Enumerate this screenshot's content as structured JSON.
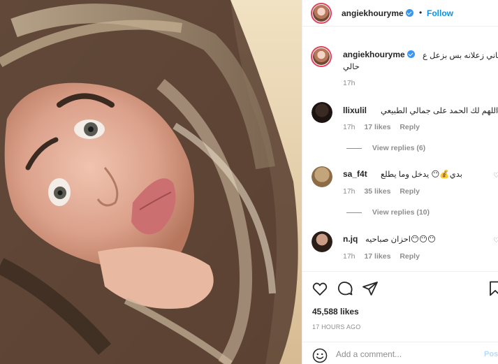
{
  "post": {
    "author": "angiekhouryme",
    "follow_label": "Follow",
    "header_separator": "•",
    "caption_line1": "انا ماني زعلانه بس بزعل ع",
    "caption_line2": "حالي",
    "caption_time": "17h"
  },
  "comments": [
    {
      "username": "llixulil",
      "text": "اللهم لك الحمد على جمالي الطبيعي ⏰",
      "time": "17h",
      "likes": "17 likes",
      "reply": "Reply",
      "view_replies": "View replies (6)"
    },
    {
      "username": "sa_f4t",
      "text": "بدي💰😶 يدخل وما يطلع",
      "time": "17h",
      "likes": "35 likes",
      "reply": "Reply",
      "view_replies": "View replies (10)"
    },
    {
      "username": "n.jq",
      "text": "احزان صباحيه😶😶😶",
      "time": "17h",
      "likes": "17 likes",
      "reply": "Reply"
    }
  ],
  "actions": {
    "like_icon": "heart-outline-icon",
    "comment_icon": "speech-bubble-icon",
    "share_icon": "paper-plane-icon",
    "save_icon": "bookmark-icon"
  },
  "stats": {
    "likes": "45,588 likes",
    "timestamp": "17 HOURS AGO"
  },
  "composer": {
    "placeholder": "Add a comment...",
    "post_label": "Pos",
    "emoji_icon": "smiley-icon"
  },
  "colors": {
    "link_blue": "#0095f6",
    "muted": "#8e8e8e",
    "text": "#262626",
    "story_ring": "#e4405f",
    "post_disabled": "#b3dbff"
  }
}
